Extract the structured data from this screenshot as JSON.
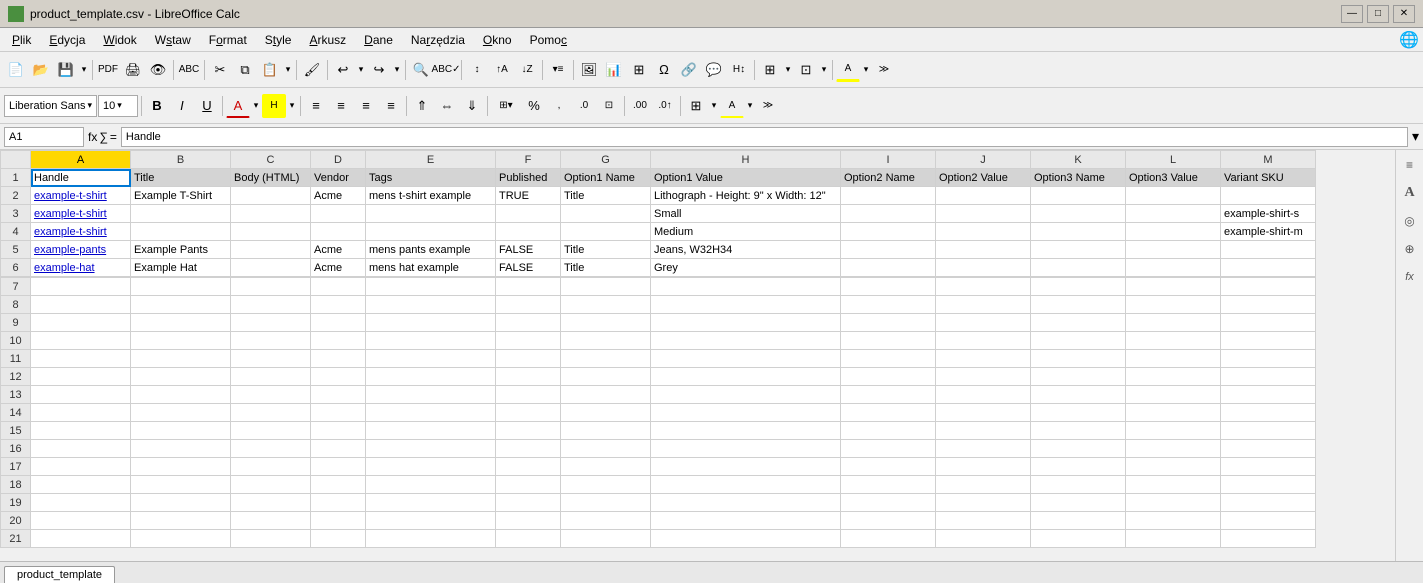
{
  "title_bar": {
    "title": "product_template.csv - LibreOffice Calc",
    "icon": "calc-icon",
    "minimize_label": "—",
    "maximize_label": "□",
    "close_label": "✕"
  },
  "menu": {
    "items": [
      "Plik",
      "Edycja",
      "Widok",
      "Wstaw",
      "Format",
      "Style",
      "Arkusz",
      "Dane",
      "Narzędzia",
      "Okno",
      "Pomoc"
    ]
  },
  "formula_bar": {
    "cell_ref": "A1",
    "content": "Handle"
  },
  "font_name": "Liberation Sans",
  "font_size": "10",
  "columns": [
    "A",
    "B",
    "C",
    "D",
    "E",
    "F",
    "G",
    "H",
    "I",
    "J",
    "K",
    "L",
    "M"
  ],
  "headers": [
    "Handle",
    "Title",
    "Body (HTML)",
    "Vendor",
    "Tags",
    "Published",
    "Option1 Name",
    "Option1 Value",
    "Option2 Name",
    "Option2 Value",
    "Option3 Name",
    "Option3 Value",
    "Variant SKU"
  ],
  "rows": [
    [
      "example-t-shirt",
      "Example T-Shirt",
      "",
      "Acme",
      "mens t-shirt example",
      "TRUE",
      "Title",
      "Lithograph - Height: 9\" x Width: 12\"",
      "",
      "",
      "",
      "",
      ""
    ],
    [
      "example-t-shirt",
      "",
      "",
      "",
      "",
      "",
      "",
      "Small",
      "",
      "",
      "",
      "",
      "example-shirt-s"
    ],
    [
      "example-t-shirt",
      "",
      "",
      "",
      "",
      "",
      "",
      "Medium",
      "",
      "",
      "",
      "",
      "example-shirt-m"
    ],
    [
      "example-pants",
      "Example Pants",
      "",
      "Acme",
      "mens pants example",
      "FALSE",
      "Title",
      "Jeans, W32H34",
      "",
      "",
      "",
      "",
      ""
    ],
    [
      "example-hat",
      "Example Hat",
      "",
      "Acme",
      "mens hat example",
      "FALSE",
      "Title",
      "Grey",
      "",
      "",
      "",
      "",
      ""
    ]
  ],
  "row_numbers": [
    1,
    2,
    3,
    4,
    5,
    6,
    7,
    8,
    9,
    10,
    11,
    12,
    13,
    14,
    15,
    16,
    17,
    18,
    19,
    20,
    21
  ],
  "empty_rows": [
    7,
    8,
    9,
    10,
    11,
    12,
    13,
    14,
    15,
    16,
    17,
    18,
    19,
    20,
    21
  ],
  "sheet_tab": "product_template",
  "right_panel_icons": [
    "≡",
    "A",
    "◎",
    "⊕",
    "fx"
  ]
}
